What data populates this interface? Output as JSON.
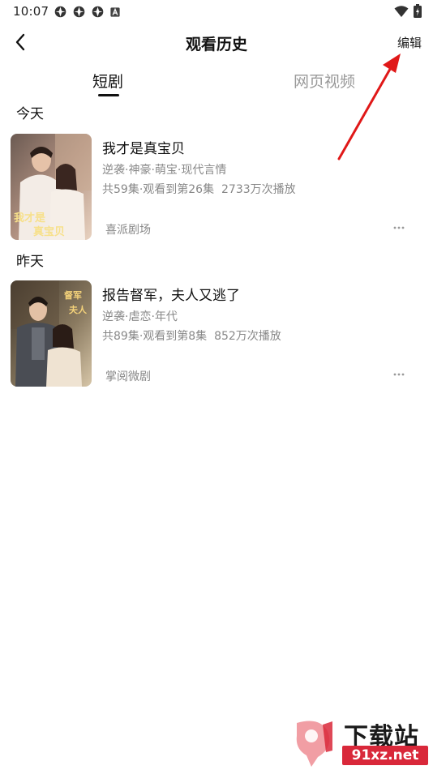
{
  "status_bar": {
    "time": "10:07"
  },
  "header": {
    "title": "观看历史",
    "edit_label": "编辑"
  },
  "tabs": [
    {
      "label": "短剧"
    },
    {
      "label": "网页视频"
    }
  ],
  "sections": [
    {
      "label": "今天",
      "items": [
        {
          "title": "我才是真宝贝",
          "tags": "逆袭·神豪·萌宝·现代言情",
          "progress": "共59集·观看到第26集",
          "plays": "2733万次播放",
          "source": "喜派剧场",
          "cover_text": "我才是真宝贝"
        }
      ]
    },
    {
      "label": "昨天",
      "items": [
        {
          "title": "报告督军，夫人又逃了",
          "tags": "逆袭·虐恋·年代",
          "progress": "共89集·观看到第8集",
          "plays": "852万次播放",
          "source": "掌阅微剧",
          "cover_text": "督军夫人"
        }
      ]
    }
  ],
  "watermark": {
    "title": "下载站",
    "url": "91xz.net"
  },
  "colors": {
    "accent": "#111111",
    "muted": "#888888",
    "inactive_tab": "#999999",
    "arrow": "#e01818",
    "watermark_red": "#d9283a"
  },
  "icons": [
    "status-app-icon",
    "status-a-icon",
    "wifi-icon",
    "battery-icon",
    "back-arrow-icon",
    "more-dots-icon"
  ]
}
